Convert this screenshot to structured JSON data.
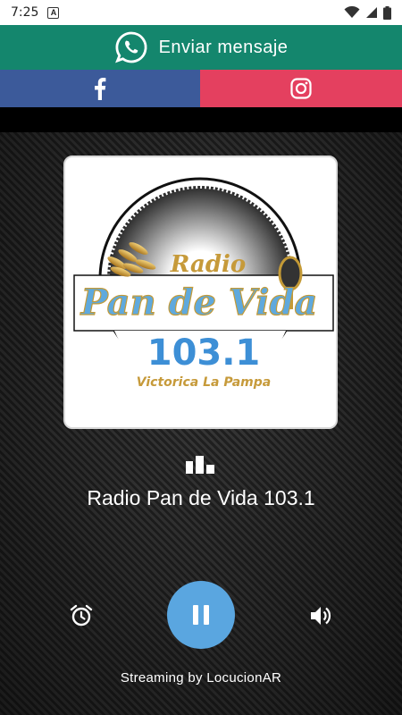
{
  "status_bar": {
    "time": "7:25",
    "notification_letter": "A"
  },
  "whatsapp": {
    "label": "Enviar mensaje",
    "icon": "whatsapp-icon"
  },
  "social": {
    "facebook_icon": "facebook-icon",
    "instagram_icon": "instagram-icon",
    "facebook_color": "#3c5a9a",
    "instagram_color": "#e4405f"
  },
  "logo": {
    "radio": "Radio",
    "name": "Pan de Vida",
    "frequency": "103.1",
    "location": "Victorica La Pampa"
  },
  "player": {
    "station_name": "Radio Pan de Vida 103.1",
    "state": "playing",
    "accent_color": "#5aa6e0"
  },
  "footer": {
    "credit": "Streaming by LocucionAR"
  }
}
